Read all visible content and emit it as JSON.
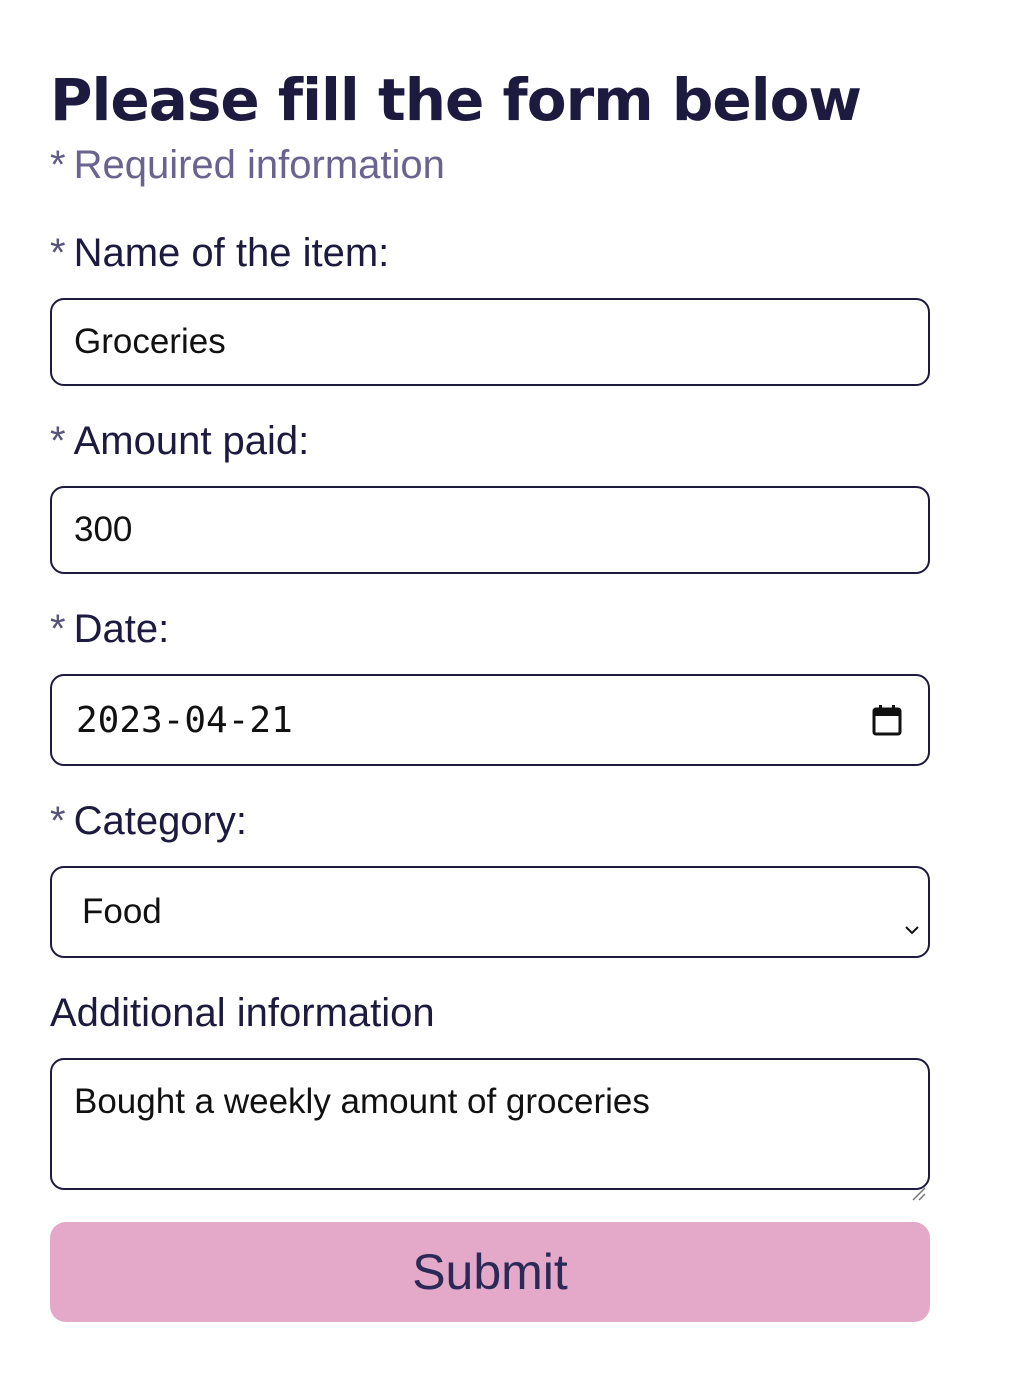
{
  "form": {
    "title": "Please fill the form below",
    "required_note": {
      "star": "*",
      "text": "Required information"
    },
    "fields": {
      "name": {
        "star": "*",
        "label": "Name of the item:",
        "value": "Groceries"
      },
      "amount": {
        "star": "*",
        "label": "Amount paid:",
        "value": "300"
      },
      "date": {
        "star": "*",
        "label": "Date:",
        "value": "2023-04-21",
        "icon": "calendar-icon"
      },
      "category": {
        "star": "*",
        "label": "Category:",
        "value": "Food",
        "icon": "chevron-down-icon"
      },
      "additional": {
        "label": "Additional information",
        "value": "Bought a weekly amount of groceries"
      }
    },
    "submit_label": "Submit"
  },
  "colors": {
    "text_dark": "#1c1a3f",
    "muted": "#6a638f",
    "submit_bg": "#e4a8c8",
    "submit_text": "#2b2a56"
  }
}
